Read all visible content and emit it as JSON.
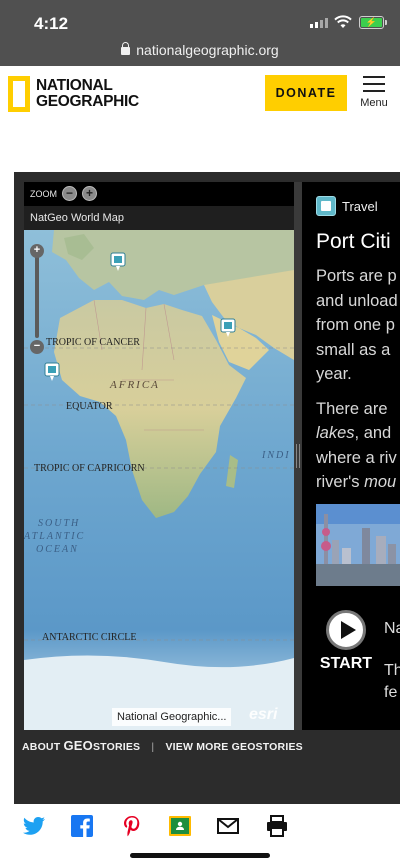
{
  "status_bar": {
    "time": "4:12",
    "battery_icon": "battery-charging-icon",
    "url": "nationalgeographic.org"
  },
  "header": {
    "logo_line1": "NATIONAL",
    "logo_line2": "GEOGRAPHIC",
    "donate_label": "DONATE",
    "menu_label": "Menu"
  },
  "map": {
    "zoom_label": "ZOOM",
    "zoom_out": "−",
    "zoom_in": "+",
    "title": "NatGeo World Map",
    "labels": {
      "tropic_cancer": "TROPIC OF CANCER",
      "africa": "AFRICA",
      "equator": "EQUATOR",
      "tropic_capricorn": "TROPIC OF CAPRICORN",
      "south_atlantic_1": "SOUTH",
      "south_atlantic_2": "ATLANTIC",
      "south_atlantic_3": "OCEAN",
      "indian": "INDI",
      "antarctic": "ANTARCTIC CIRCLE"
    },
    "attribution": "National Geographic...",
    "esri": "esri",
    "slider_plus": "+",
    "slider_minus": "−"
  },
  "story": {
    "category": "Travel",
    "title": "Port Citi",
    "paragraph1": [
      "Ports are p",
      "and unload",
      "from one p",
      "small as a",
      "year."
    ],
    "paragraph2_line1": "There are",
    "paragraph2_line2_em": "lakes",
    "paragraph2_line2_rest": ", and",
    "paragraph2_line3": "where a riv",
    "paragraph2_line4_pre": "river's ",
    "paragraph2_line4_em": "mou",
    "start_label": "START",
    "narration_line1": "Na",
    "narration_line2": "Th",
    "narration_line3": "fe"
  },
  "footer_links": {
    "about_pre": "ABOUT ",
    "about_geo": "GEO",
    "about_post": "STORIES",
    "separator": "|",
    "view_more": "VIEW MORE GEOSTORIES"
  },
  "share_icons": [
    "twitter-icon",
    "facebook-icon",
    "pinterest-icon",
    "google-classroom-icon",
    "email-icon",
    "print-icon"
  ],
  "colors": {
    "brand_yellow": "#ffce00",
    "widget_bg": "#2c2c2c",
    "twitter": "#1da1f2",
    "facebook": "#1877f2",
    "pinterest": "#e60023",
    "classroom": "#1e8e3e"
  }
}
